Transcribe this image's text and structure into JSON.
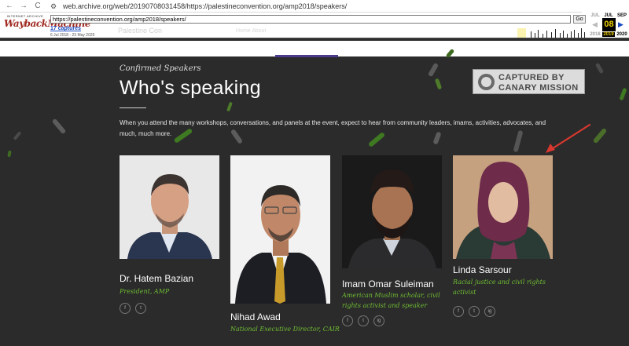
{
  "browser": {
    "url": "web.archive.org/web/20190708031458/https://palestineconvention.org/amp2018/speakers/",
    "nav": {
      "back": "←",
      "forward": "→",
      "reload": "C",
      "site_info": "⚙"
    }
  },
  "wayback": {
    "logo_top": "INTERNET ARCHIVE",
    "logo_main": "WaybackMachine",
    "input_url": "https://palestineconvention.org/amp2018/speakers/",
    "go_label": "Go",
    "captures_label": "17 captures",
    "date_range": "6 Jul 2018 - 23 May 2025",
    "ghost_text_1": "Palestine Con",
    "ghost_text_2": "Home   About",
    "calendar": {
      "prev_month": "JUL",
      "current_month": "JUL",
      "next_month": "SEP",
      "day": "08",
      "prev_year": "2018",
      "current_year": "2019",
      "next_year": "2020",
      "prev_arrow": "◀",
      "next_arrow": "▶"
    }
  },
  "section": {
    "eyebrow": "Confirmed Speakers",
    "title": "Who's speaking",
    "intro": "When you attend the many workshops, conversations, and panels at the event, expect to hear from community leaders, imams, activities, advocates, and much, much more."
  },
  "stamp": {
    "line1": "CAPTURED BY",
    "line2": "CANARY MISSION"
  },
  "speakers": [
    {
      "name": "Dr. Hatem Bazian",
      "role": "President, AMP",
      "social": [
        "f",
        "t"
      ]
    },
    {
      "name": "Nihad Awad",
      "role": "National Executive Director, CAIR",
      "social": []
    },
    {
      "name": "Imam Omar Suleiman",
      "role": "American Muslim scholar, civil rights activist and speaker",
      "social": [
        "f",
        "t",
        "ig"
      ]
    },
    {
      "name": "Linda Sarsour",
      "role": "Racial justice and civil rights activist",
      "social": [
        "f",
        "t",
        "ig"
      ]
    }
  ],
  "colors": {
    "page_bg": "#2b2b2b",
    "role_green": "#6fbd33",
    "annotation_red": "#d9382f",
    "calendar_yellow": "#f0d000"
  }
}
